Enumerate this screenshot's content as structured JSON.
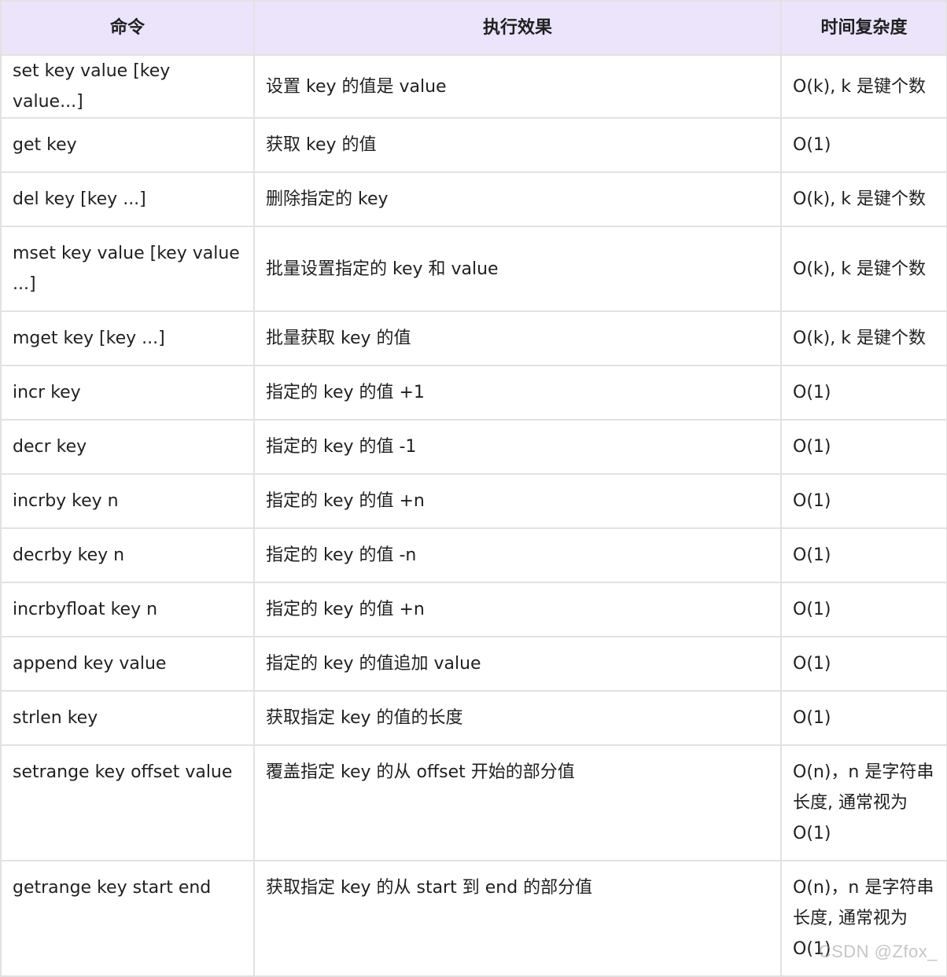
{
  "table": {
    "headers": [
      "命令",
      "执行效果",
      "时间复杂度"
    ],
    "rows": [
      [
        "set key value [key value...]",
        "设置 key 的值是 value",
        "O(k), k 是键个数"
      ],
      [
        "get key",
        "获取 key 的值",
        "O(1)"
      ],
      [
        "del key [key ...]",
        "删除指定的 key",
        "O(k), k 是键个数"
      ],
      [
        "mset key value [key value ...]",
        "批量设置指定的 key 和 value",
        "O(k), k 是键个数"
      ],
      [
        "mget key [key ...]",
        "批量获取 key 的值",
        "O(k), k 是键个数"
      ],
      [
        "incr key",
        "指定的 key 的值 +1",
        "O(1)"
      ],
      [
        "decr key",
        "指定的 key 的值 -1",
        "O(1)"
      ],
      [
        "incrby key n",
        "指定的 key 的值 +n",
        "O(1)"
      ],
      [
        "decrby key n",
        "指定的 key 的值 -n",
        "O(1)"
      ],
      [
        "incrbyfloat key n",
        "指定的 key 的值 +n",
        "O(1)"
      ],
      [
        "append key value",
        "指定的 key 的值追加 value",
        "O(1)"
      ],
      [
        "strlen key",
        "获取指定 key 的值的长度",
        "O(1)"
      ],
      [
        "setrange key offset value",
        "覆盖指定 key 的从 offset 开始的部分值",
        "O(n)，n 是字符串长度, 通常视为 O(1)"
      ],
      [
        "getrange key start end",
        "获取指定 key 的从 start 到 end 的部分值",
        "O(n)，n 是字符串长度, 通常视为 O(1)"
      ]
    ]
  },
  "watermark": "CSDN @Zfox_"
}
